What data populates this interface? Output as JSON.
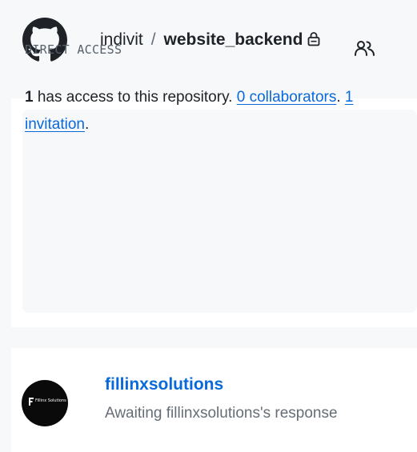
{
  "header": {
    "owner": "indivit",
    "separator": "/",
    "repo": "website_backend",
    "icons": [
      "github-logo-icon",
      "lock-icon"
    ]
  },
  "access": {
    "title": "DIRECT ACCESS",
    "icon": "people-icon",
    "count": "1",
    "text_after_count": " has access to this repository. ",
    "collaborators_link": "0 collaborators",
    "between": ". ",
    "invitations_link": "1 invitation",
    "end": "."
  },
  "member": {
    "name": "fillinxsolutions",
    "status": "Awaiting fillinxsolutions's response",
    "avatar_text": "Fillinx Solutions"
  },
  "colors": {
    "link": "#0969da",
    "background": "#f6f8fa",
    "panel": "#ffffff",
    "text": "#1f2328",
    "muted": "#656d76"
  }
}
